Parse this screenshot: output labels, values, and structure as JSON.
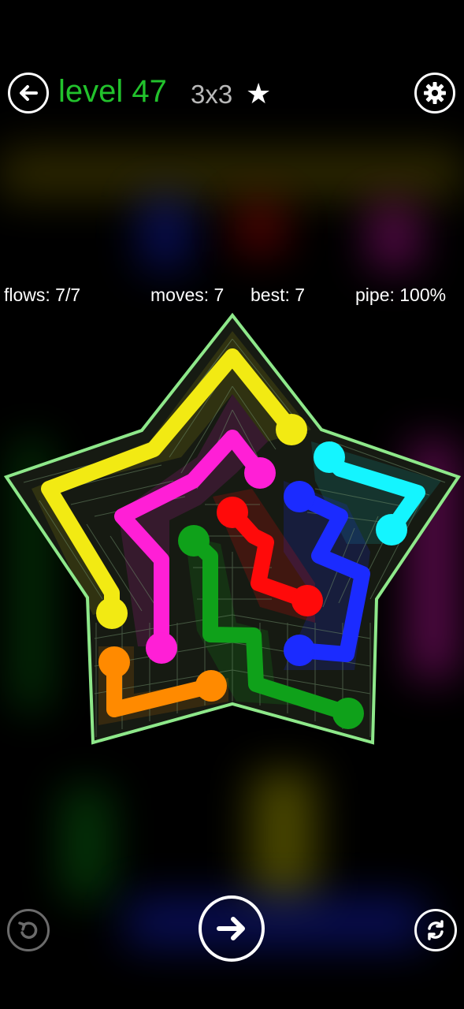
{
  "header": {
    "level_label": "level 47",
    "size_label": "3x3",
    "star_glyph": "★",
    "back_icon": "back-arrow-icon",
    "settings_icon": "gear-icon"
  },
  "stats": {
    "flows": "flows: 7/7",
    "moves": "moves: 7",
    "best": "best: 7",
    "pipe": "pipe: 100%"
  },
  "board": {
    "shape": "star",
    "border_color": "#8ee88a",
    "flows": [
      {
        "name": "yellow",
        "color": "#f2ea13"
      },
      {
        "name": "magenta",
        "color": "#ff1fd6"
      },
      {
        "name": "cyan",
        "color": "#14f5ff"
      },
      {
        "name": "blue",
        "color": "#1b2bff"
      },
      {
        "name": "red",
        "color": "#ff0a0a"
      },
      {
        "name": "green",
        "color": "#0fa11a"
      },
      {
        "name": "orange",
        "color": "#ff8a00"
      }
    ]
  },
  "footer": {
    "undo_icon": "undo-icon",
    "next_icon": "next-arrow-icon",
    "restart_icon": "restart-icon"
  }
}
